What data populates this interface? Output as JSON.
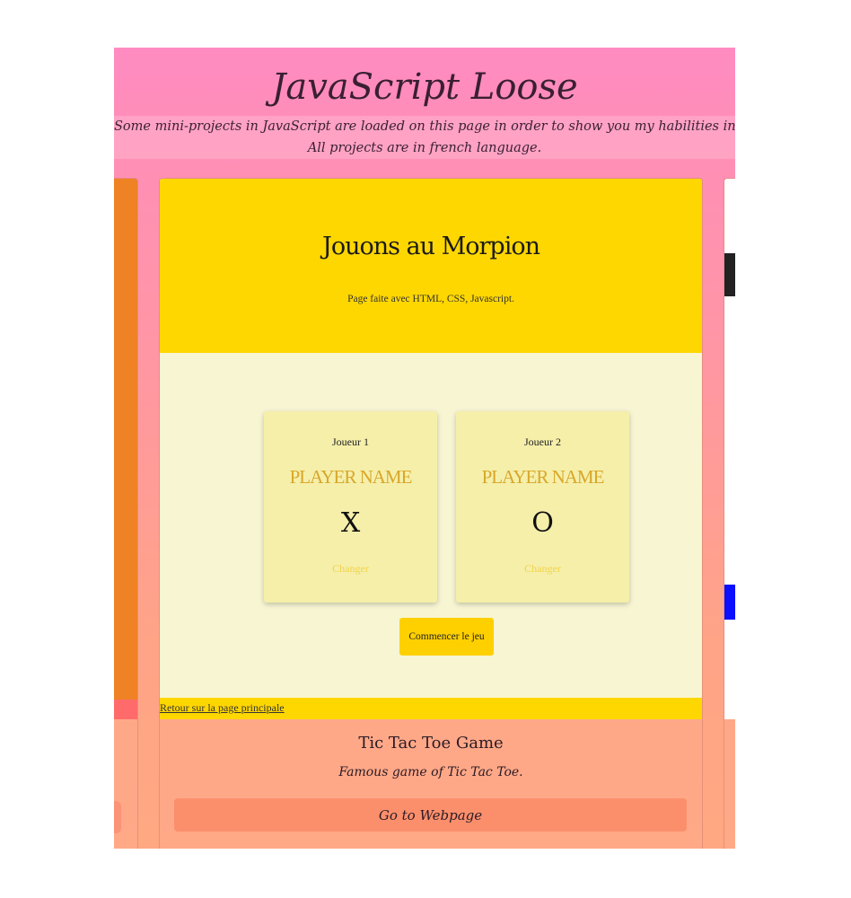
{
  "header": {
    "title": "JavaScript Loose",
    "subtitle_line1": "Some mini-projects in JavaScript are loaded on this page in order to show you my habilities in JavaScript.",
    "subtitle_line2": "All projects are in french language."
  },
  "project": {
    "preview": {
      "title": "Jouons au Morpion",
      "subtitle": "Page faite avec HTML, CSS, Javascript.",
      "players": [
        {
          "label": "Joueur 1",
          "name": "PLAYER NAME",
          "symbol": "X",
          "change_label": "Changer"
        },
        {
          "label": "Joueur 2",
          "name": "PLAYER NAME",
          "symbol": "O",
          "change_label": "Changer"
        }
      ],
      "start_button": "Commencer le jeu",
      "back_link": "Retour sur la page principale"
    },
    "title": "Tic Tac Toe Game",
    "description": "Famous game of Tic Tac Toe.",
    "button": "Go to Webpage"
  },
  "colors": {
    "gradient_top": "#ff8bc0",
    "gradient_bottom": "#ffa882",
    "morpion_yellow": "#ffd700",
    "player_box": "#f5efaa",
    "button_coral": "#fb8f6c",
    "left_card_orange": "#ee8224",
    "right_card_blue": "#0a10ff"
  }
}
